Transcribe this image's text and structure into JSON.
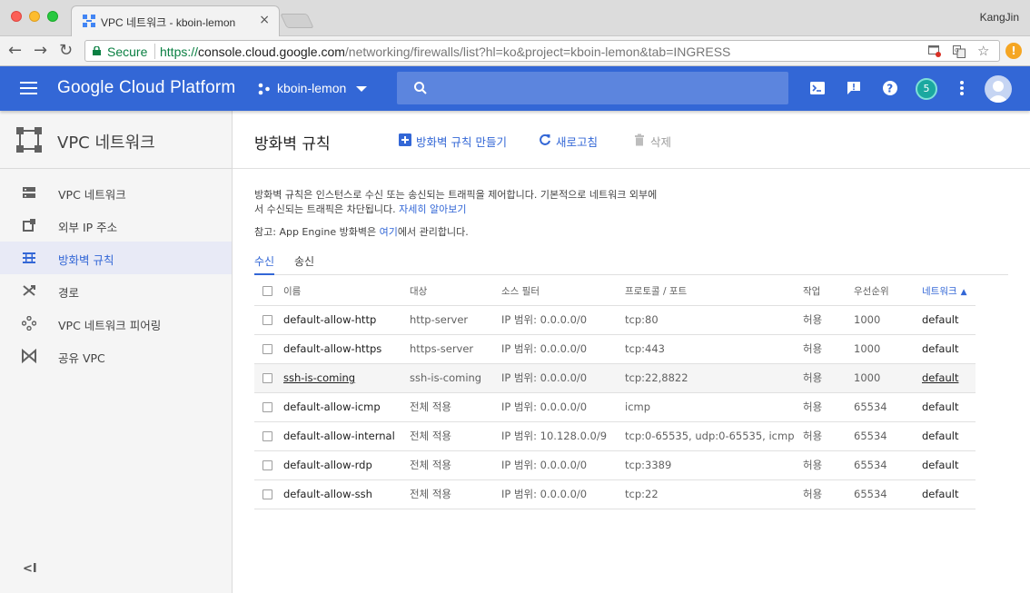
{
  "browser": {
    "tab_title": "VPC 네트워크 - kboin-lemon",
    "tab_close": "×",
    "profile_name": "KangJin",
    "secure_label": "Secure",
    "url_scheme": "https://",
    "url_host": "console.cloud.google.com",
    "url_path": "/networking/firewalls/list?hl=ko&project=kboin-lemon&tab=INGRESS",
    "back": "←",
    "forward": "→",
    "reload": "↻",
    "warn": "!"
  },
  "header": {
    "brand": "Google Cloud Platform",
    "project": "kboin-lemon",
    "notification_count": "5"
  },
  "sidebar": {
    "title": "VPC 네트워크",
    "items": [
      {
        "label": "VPC 네트워크",
        "icon": "vpc-network-icon"
      },
      {
        "label": "외부 IP 주소",
        "icon": "external-ip-icon"
      },
      {
        "label": "방화벽 규칙",
        "icon": "firewall-icon",
        "active": true
      },
      {
        "label": "경로",
        "icon": "routes-icon"
      },
      {
        "label": "VPC 네트워크 피어링",
        "icon": "peering-icon"
      },
      {
        "label": "공유 VPC",
        "icon": "shared-vpc-icon"
      }
    ],
    "collapse": "<I"
  },
  "main": {
    "title": "방화벽 규칙",
    "create_label": "방화벽 규칙 만들기",
    "refresh_label": "새로고침",
    "delete_label": "삭제",
    "desc_text": "방화벽 규칙은 인스턴스로 수신 또는 송신되는 트래픽을 제어합니다. 기본적으로 네트워크 외부에서 수신되는 트래픽은 차단됩니다.",
    "desc_link": "자세히 알아보기",
    "note_prefix": "참고: App Engine 방화벽은 ",
    "note_link": "여기",
    "note_suffix": "에서 관리합니다.",
    "tabs": [
      "수신",
      "송신"
    ]
  },
  "table": {
    "columns": [
      "이름",
      "대상",
      "소스 필터",
      "프로토콜 / 포트",
      "작업",
      "우선순위",
      "네트워크"
    ],
    "sort_indicator": "▲",
    "rows": [
      {
        "name": "default-allow-http",
        "target": "http-server",
        "source": "IP 범위: 0.0.0.0/0",
        "protocol": "tcp:80",
        "action": "허용",
        "priority": "1000",
        "network": "default"
      },
      {
        "name": "default-allow-https",
        "target": "https-server",
        "source": "IP 범위: 0.0.0.0/0",
        "protocol": "tcp:443",
        "action": "허용",
        "priority": "1000",
        "network": "default"
      },
      {
        "name": "ssh-is-coming",
        "target": "ssh-is-coming",
        "source": "IP 범위: 0.0.0.0/0",
        "protocol": "tcp:22,8822",
        "action": "허용",
        "priority": "1000",
        "network": "default"
      },
      {
        "name": "default-allow-icmp",
        "target": "전체 적용",
        "source": "IP 범위: 0.0.0.0/0",
        "protocol": "icmp",
        "action": "허용",
        "priority": "65534",
        "network": "default"
      },
      {
        "name": "default-allow-internal",
        "target": "전체 적용",
        "source": "IP 범위: 10.128.0.0/9",
        "protocol": "tcp:0-65535, udp:0-65535, icmp",
        "action": "허용",
        "priority": "65534",
        "network": "default"
      },
      {
        "name": "default-allow-rdp",
        "target": "전체 적용",
        "source": "IP 범위: 0.0.0.0/0",
        "protocol": "tcp:3389",
        "action": "허용",
        "priority": "65534",
        "network": "default"
      },
      {
        "name": "default-allow-ssh",
        "target": "전체 적용",
        "source": "IP 범위: 0.0.0.0/0",
        "protocol": "tcp:22",
        "action": "허용",
        "priority": "65534",
        "network": "default"
      }
    ]
  },
  "colors": {
    "header": "#3367d6",
    "accent": "#3367d6",
    "secure": "#0b8043"
  }
}
